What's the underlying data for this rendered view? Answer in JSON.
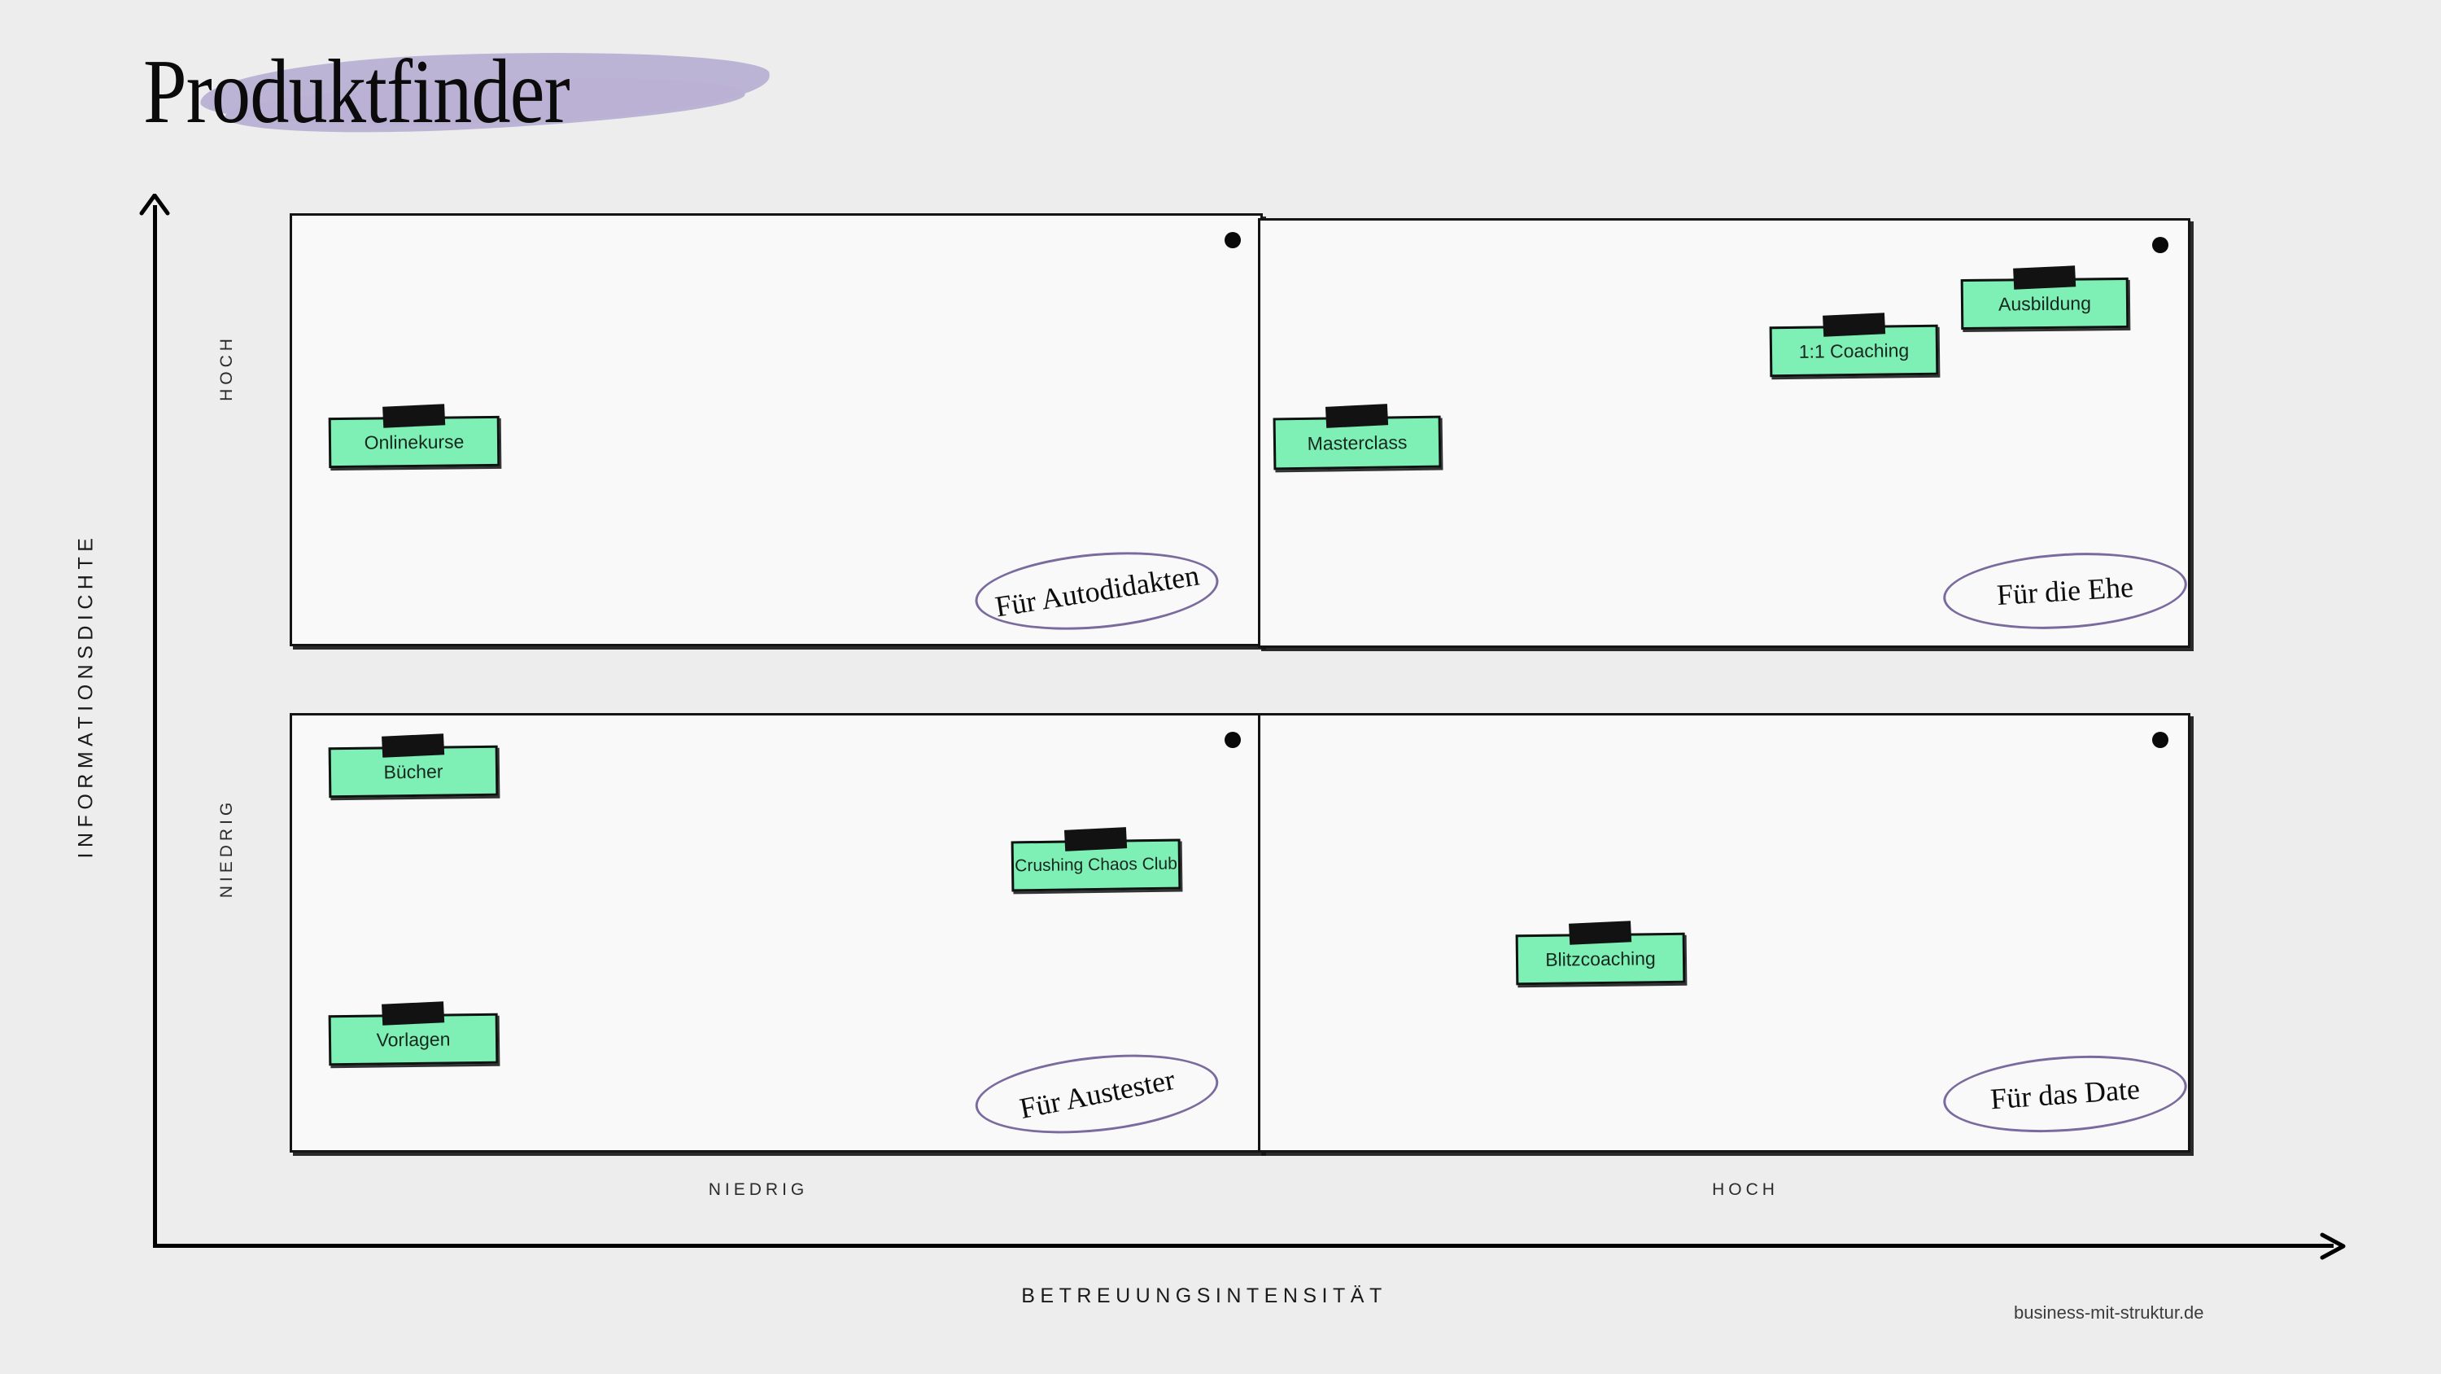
{
  "page": {
    "title": "Produktfinder",
    "background_color": "#EDEDED",
    "footer_credit": "business-mit-struktur.de"
  },
  "axes": {
    "y_label": "INFORMATIONSDICHTE",
    "x_label": "BETREUUNGSINTENSITÄT",
    "y_ticks": [
      "HOCH",
      "NIEDRIG"
    ],
    "x_ticks": [
      "NIEDRIG",
      "HOCH"
    ]
  },
  "quadrants": [
    {
      "id": "top-left",
      "position": "hoch-informationsdichte / niedrig-betreuungsintensitaet",
      "caption": "Für Autodidakten",
      "notes": [
        "Onlinekurse"
      ]
    },
    {
      "id": "top-right",
      "position": "hoch-informationsdichte / hoch-betreuungsintensitaet",
      "caption": "Für die Ehe",
      "notes": [
        "Masterclass",
        "1:1 Coaching",
        "Ausbildung"
      ]
    },
    {
      "id": "bottom-left",
      "position": "niedrig-informationsdichte / niedrig-betreuungsintensitaet",
      "caption": "Für Austester",
      "notes": [
        "Bücher",
        "Crushing Chaos Club",
        "Vorlagen"
      ]
    },
    {
      "id": "bottom-right",
      "position": "niedrig-informationsdichte / hoch-betreuungsintensitaet",
      "caption": "Für das Date",
      "notes": [
        "Blitzcoaching"
      ]
    }
  ],
  "colors": {
    "note_fill": "#7EF0B6",
    "note_border": "#111111",
    "tape": "#121212",
    "ellipse_stroke": "#7A6A9E",
    "title_highlight": "#B9B1D4",
    "card_fill": "#F9F9F9",
    "card_border": "#141414"
  },
  "chart_data": {
    "type": "scatter",
    "title": "Produktfinder",
    "xlabel": "BETREUUNGSINTENSITÄT",
    "ylabel": "INFORMATIONSDICHTE",
    "x_categories": [
      "NIEDRIG",
      "HOCH"
    ],
    "y_categories": [
      "NIEDRIG",
      "HOCH"
    ],
    "grid": false,
    "legend": "none",
    "quadrant_captions": {
      "top_left": "Für Autodidakten",
      "top_right": "Für die Ehe",
      "bottom_left": "Für Austester",
      "bottom_right": "Für das Date"
    },
    "points": [
      {
        "label": "Onlinekurse",
        "x": "NIEDRIG",
        "y": "HOCH",
        "quadrant": "top-left"
      },
      {
        "label": "Masterclass",
        "x": "HOCH",
        "y": "HOCH",
        "quadrant": "top-right"
      },
      {
        "label": "1:1 Coaching",
        "x": "HOCH",
        "y": "HOCH",
        "quadrant": "top-right"
      },
      {
        "label": "Ausbildung",
        "x": "HOCH",
        "y": "HOCH",
        "quadrant": "top-right"
      },
      {
        "label": "Bücher",
        "x": "NIEDRIG",
        "y": "NIEDRIG",
        "quadrant": "bottom-left"
      },
      {
        "label": "Crushing Chaos Club",
        "x": "NIEDRIG",
        "y": "NIEDRIG",
        "quadrant": "bottom-left"
      },
      {
        "label": "Vorlagen",
        "x": "NIEDRIG",
        "y": "NIEDRIG",
        "quadrant": "bottom-left"
      },
      {
        "label": "Blitzcoaching",
        "x": "HOCH",
        "y": "NIEDRIG",
        "quadrant": "bottom-right"
      }
    ]
  }
}
